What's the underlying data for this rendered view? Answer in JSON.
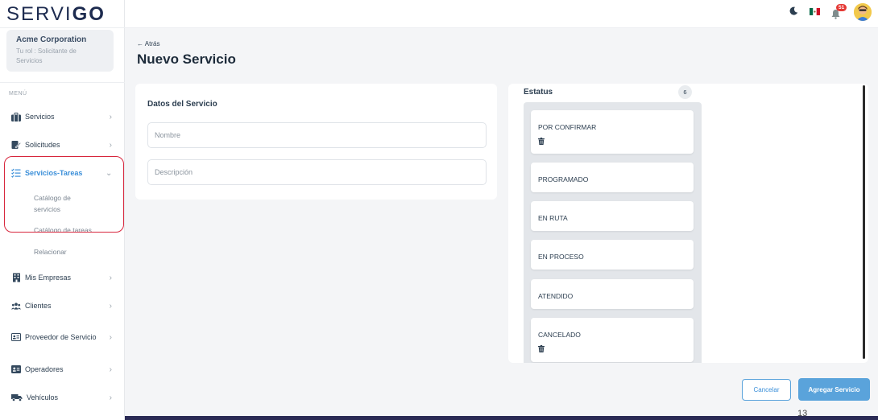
{
  "brand": {
    "logo_text": "SERVI",
    "logo_go": "GO"
  },
  "company": {
    "name": "Acme Corporation",
    "role": "Tu rol : Solicitante de Servicios"
  },
  "menu_label": "MENÚ",
  "sidebar": {
    "items": [
      {
        "label": "Servicios",
        "icon": "briefcase-icon"
      },
      {
        "label": "Solicitudes",
        "icon": "edit-document-icon"
      },
      {
        "label": "Servicios-Tareas",
        "icon": "checklist-icon",
        "active": true
      },
      {
        "label": "Mis Empresas",
        "icon": "building-icon"
      },
      {
        "label": "Clientes",
        "icon": "users-icon"
      },
      {
        "label": "Proveedor de Servicio",
        "icon": "id-card-icon"
      },
      {
        "label": "Operadores",
        "icon": "operator-card-icon"
      },
      {
        "label": "Vehículos",
        "icon": "truck-icon"
      }
    ],
    "subitems": [
      "Catálogo de servicios",
      "Catálogo de tareas",
      "Relacionar"
    ]
  },
  "topbar": {
    "notifications_count": "51"
  },
  "header": {
    "back_label": "← Atrás",
    "title": "Nuevo Servicio"
  },
  "form": {
    "title": "Datos del Servicio",
    "name_placeholder": "Nombre",
    "description_placeholder": "Descripción"
  },
  "status": {
    "title": "Estatus",
    "count": "6",
    "items": [
      {
        "label": "POR CONFIRMAR",
        "deletable": true
      },
      {
        "label": "PROGRAMADO",
        "deletable": false
      },
      {
        "label": "EN RUTA",
        "deletable": false
      },
      {
        "label": "EN PROCESO",
        "deletable": false
      },
      {
        "label": "ATENDIDO",
        "deletable": false
      },
      {
        "label": "CANCELADO",
        "deletable": true
      }
    ]
  },
  "actions": {
    "cancel_label": "Cancelar",
    "submit_label": "Agregar Servicio"
  },
  "page_number": "13",
  "colors": {
    "accent": "#3b8fd9",
    "primary_button": "#5aa3db",
    "highlight": "#d7263d",
    "brand": "#1d2b4f"
  }
}
